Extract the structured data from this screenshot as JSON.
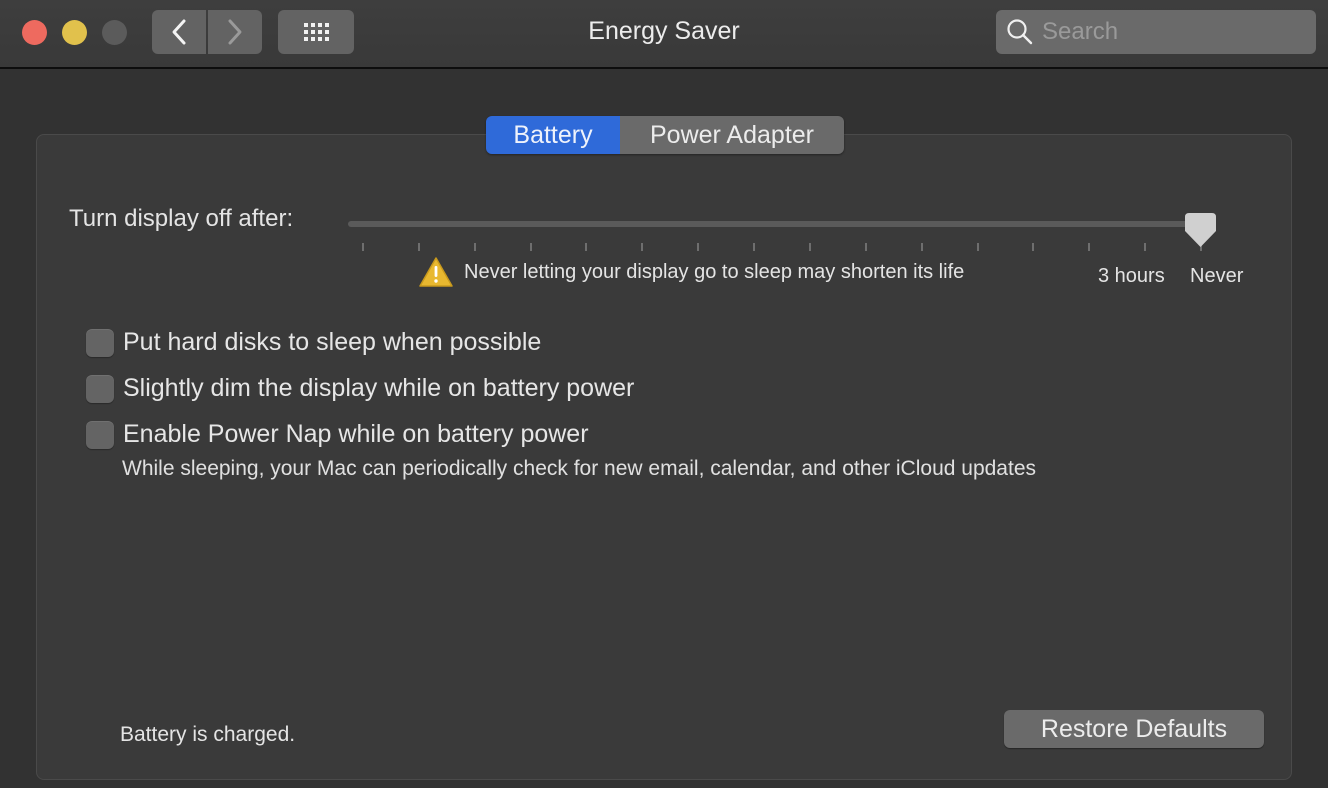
{
  "window": {
    "title": "Energy Saver",
    "search_placeholder": "Search",
    "search_value": ""
  },
  "icons": {
    "close": "close-icon",
    "minimize": "minimize-icon",
    "zoom": "zoom-icon-disabled",
    "back": "chevron-left-icon",
    "forward": "chevron-right-icon",
    "show_all": "grid-icon",
    "search": "magnifier-icon",
    "warning": "warning-triangle-icon"
  },
  "tabs": [
    {
      "label": "Battery",
      "selected": true
    },
    {
      "label": "Power Adapter",
      "selected": false
    }
  ],
  "display_sleep": {
    "label": "Turn display off after:",
    "tick_count": 16,
    "selected_index": 15,
    "selected_value": "Never",
    "labels": {
      "three_hours": "3 hours",
      "never": "Never"
    },
    "warning": "Never letting your display go to sleep may shorten its life"
  },
  "options": [
    {
      "label": "Put hard disks to sleep when possible",
      "checked": false
    },
    {
      "label": "Slightly dim the display while on battery power",
      "checked": false
    },
    {
      "label": "Enable Power Nap while on battery power",
      "checked": false,
      "description": "While sleeping, your Mac can periodically check for new email, calendar, and other iCloud updates"
    }
  ],
  "status": "Battery is charged.",
  "restore_button": "Restore Defaults",
  "colors": {
    "accent": "#2f6ad9",
    "warning": "#e8b830",
    "close": "#ee6a5f",
    "minimize": "#e1c14c"
  }
}
